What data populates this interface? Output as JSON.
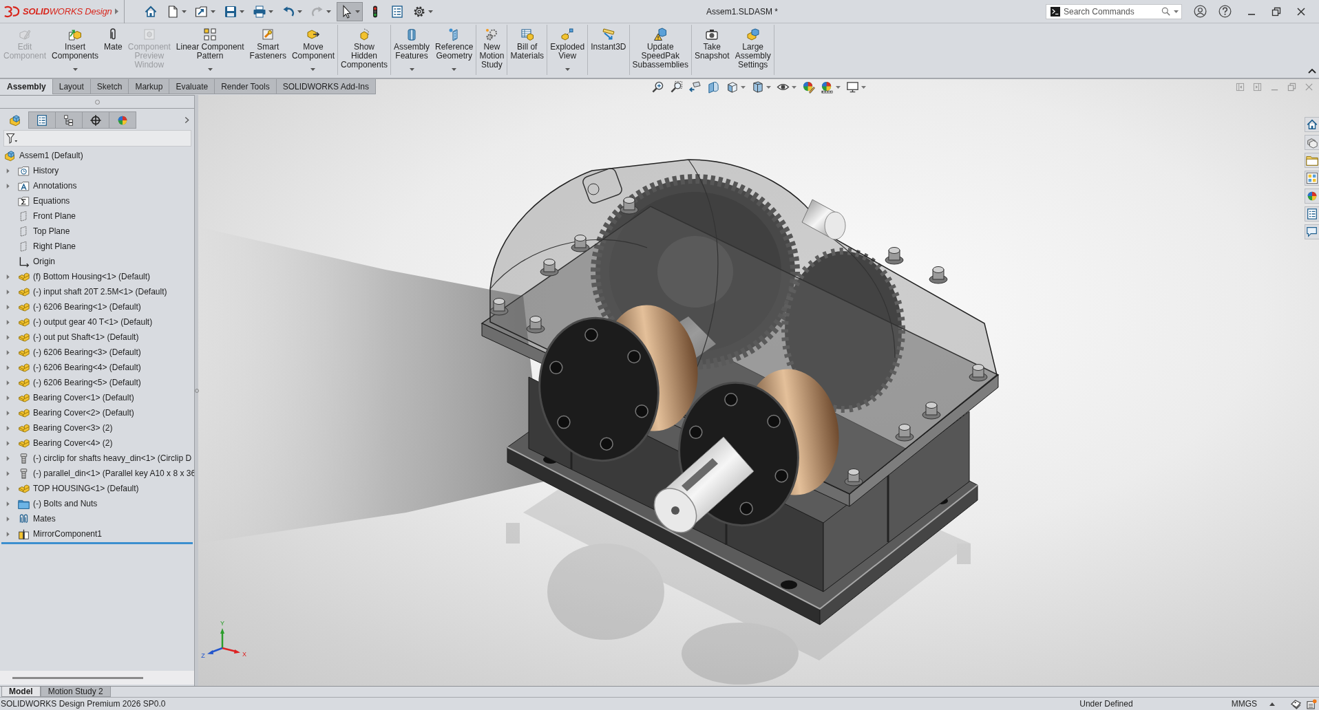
{
  "title_bar": {
    "logo_text": "**SOLID**WORKS Design",
    "quick_access": [
      {
        "kind": "home",
        "active": false,
        "disabled": false,
        "dropdown": false
      },
      {
        "kind": "new",
        "active": false,
        "disabled": false,
        "dropdown": true
      },
      {
        "kind": "open",
        "active": false,
        "disabled": false,
        "dropdown": true
      },
      {
        "kind": "save",
        "active": false,
        "disabled": false,
        "dropdown": true
      },
      {
        "kind": "print",
        "active": false,
        "disabled": false,
        "dropdown": true
      },
      {
        "kind": "undo",
        "active": false,
        "disabled": false,
        "dropdown": true
      },
      {
        "kind": "redo",
        "active": false,
        "disabled": true,
        "dropdown": true
      },
      {
        "kind": "select",
        "active": true,
        "disabled": false,
        "dropdown": true
      },
      {
        "kind": "rebuild",
        "active": false,
        "disabled": false,
        "dropdown": false
      },
      {
        "kind": "file-properties",
        "active": false,
        "disabled": false,
        "dropdown": false
      },
      {
        "kind": "options",
        "active": false,
        "disabled": false,
        "dropdown": true
      }
    ],
    "document_title": "Assem1.SLDASM *",
    "search": {
      "placeholder": "Search Commands"
    }
  },
  "command_manager": {
    "groups": [
      {
        "buttons": [
          {
            "label": "Edit\nComponent",
            "kind": "edit-component",
            "disabled": true,
            "dropdown": false
          },
          {
            "label": "Insert\nComponents",
            "kind": "insert-components",
            "disabled": false,
            "dropdown": true
          },
          {
            "label": "Mate",
            "kind": "mate",
            "disabled": false,
            "dropdown": false
          },
          {
            "label": "Component\nPreview\nWindow",
            "kind": "component-preview",
            "disabled": true,
            "dropdown": false
          },
          {
            "label": "Linear Component\nPattern",
            "kind": "linear-pattern",
            "disabled": false,
            "dropdown": true
          },
          {
            "label": "Smart\nFasteners",
            "kind": "smart-fasteners",
            "disabled": false,
            "dropdown": false
          },
          {
            "label": "Move\nComponent",
            "kind": "move-component",
            "disabled": false,
            "dropdown": true
          }
        ]
      },
      {
        "buttons": [
          {
            "label": "Show\nHidden\nComponents",
            "kind": "show-hidden",
            "disabled": false,
            "dropdown": false
          }
        ]
      },
      {
        "buttons": [
          {
            "label": "Assembly\nFeatures",
            "kind": "assembly-features",
            "disabled": false,
            "dropdown": true
          },
          {
            "label": "Reference\nGeometry",
            "kind": "reference-geometry",
            "disabled": false,
            "dropdown": true
          }
        ]
      },
      {
        "buttons": [
          {
            "label": "New\nMotion\nStudy",
            "kind": "motion-study",
            "disabled": false,
            "dropdown": false
          }
        ]
      },
      {
        "buttons": [
          {
            "label": "Bill of\nMaterials",
            "kind": "bom",
            "disabled": false,
            "dropdown": false
          }
        ]
      },
      {
        "buttons": [
          {
            "label": "Exploded\nView",
            "kind": "exploded-view",
            "disabled": false,
            "dropdown": true
          }
        ]
      },
      {
        "buttons": [
          {
            "label": "Instant3D",
            "kind": "instant3d",
            "disabled": false,
            "dropdown": false
          }
        ]
      },
      {
        "buttons": [
          {
            "label": "Update\nSpeedPak\nSubassemblies",
            "kind": "speedpak",
            "disabled": false,
            "dropdown": false
          }
        ]
      },
      {
        "buttons": [
          {
            "label": "Take\nSnapshot",
            "kind": "snapshot",
            "disabled": false,
            "dropdown": false
          },
          {
            "label": "Large\nAssembly\nSettings",
            "kind": "large-assembly",
            "disabled": false,
            "dropdown": false
          }
        ]
      }
    ]
  },
  "command_tabs": [
    {
      "label": "Assembly",
      "selected": true
    },
    {
      "label": "Layout",
      "selected": false
    },
    {
      "label": "Sketch",
      "selected": false
    },
    {
      "label": "Markup",
      "selected": false
    },
    {
      "label": "Evaluate",
      "selected": false
    },
    {
      "label": "Render Tools",
      "selected": false
    },
    {
      "label": "SOLIDWORKS Add-Ins",
      "selected": false
    }
  ],
  "view_toolbar": [
    {
      "kind": "zoom-fit",
      "dropdown": false
    },
    {
      "kind": "zoom-area",
      "dropdown": false
    },
    {
      "kind": "previous-view",
      "dropdown": false
    },
    {
      "kind": "section-view",
      "dropdown": false
    },
    {
      "kind": "view-orientation",
      "dropdown": true
    },
    {
      "kind": "display-style",
      "dropdown": true
    },
    {
      "kind": "hide-show",
      "dropdown": true
    },
    {
      "kind": "edit-appearance",
      "dropdown": false
    },
    {
      "kind": "apply-scene",
      "dropdown": true
    },
    {
      "kind": "view-settings",
      "dropdown": true
    }
  ],
  "feature_manager": {
    "tabs": [
      {
        "kind": "feature-tree",
        "selected": true
      },
      {
        "kind": "property-manager",
        "selected": false
      },
      {
        "kind": "configuration-manager",
        "selected": false
      },
      {
        "kind": "dimxpert",
        "selected": false
      },
      {
        "kind": "display-manager",
        "selected": false
      }
    ],
    "tree": {
      "label": "Assem1 (Default)",
      "kind": "assembly",
      "selected": false,
      "children": [
        {
          "label": "History",
          "kind": "history",
          "expanded": false,
          "selected": false
        },
        {
          "label": "Annotations",
          "kind": "annotations",
          "expanded": false,
          "selected": false
        },
        {
          "label": "Equations",
          "kind": "equations",
          "selected": false
        },
        {
          "label": "Front Plane",
          "kind": "plane",
          "selected": false
        },
        {
          "label": "Top Plane",
          "kind": "plane",
          "selected": false
        },
        {
          "label": "Right Plane",
          "kind": "plane",
          "selected": false
        },
        {
          "label": "Origin",
          "kind": "origin",
          "selected": false
        },
        {
          "label": "(f) Bottom Housing<1> (Default)",
          "kind": "part",
          "expanded": false,
          "selected": false
        },
        {
          "label": "(-) input shaft 20T 2.5M<1> (Default)",
          "kind": "part",
          "expanded": false,
          "selected": false
        },
        {
          "label": "(-) 6206 Bearing<1> (Default)",
          "kind": "part",
          "expanded": false,
          "selected": false
        },
        {
          "label": "(-) output gear 40 T<1> (Default)",
          "kind": "part",
          "expanded": false,
          "selected": false
        },
        {
          "label": "(-) out put Shaft<1> (Default)",
          "kind": "part",
          "expanded": false,
          "selected": false
        },
        {
          "label": "(-) 6206 Bearing<3> (Default)",
          "kind": "part",
          "expanded": false,
          "selected": false
        },
        {
          "label": "(-) 6206 Bearing<4> (Default)",
          "kind": "part",
          "expanded": false,
          "selected": false
        },
        {
          "label": "(-) 6206 Bearing<5> (Default)",
          "kind": "part",
          "expanded": false,
          "selected": false
        },
        {
          "label": "Bearing Cover<1> (Default)",
          "kind": "part",
          "expanded": false,
          "selected": false
        },
        {
          "label": "Bearing Cover<2> (Default)",
          "kind": "part",
          "expanded": false,
          "selected": false
        },
        {
          "label": "Bearing Cover<3> (2)",
          "kind": "part",
          "expanded": false,
          "selected": false
        },
        {
          "label": "Bearing Cover<4> (2)",
          "kind": "part",
          "expanded": false,
          "selected": false
        },
        {
          "label": "(-) circlip for shafts heavy_din<1> (Circlip D",
          "kind": "toolbox-part",
          "expanded": false,
          "selected": false
        },
        {
          "label": "(-) parallel_din<1> (Parallel key A10 x 8 x 36",
          "kind": "toolbox-part",
          "expanded": false,
          "selected": false
        },
        {
          "label": "TOP HOUSING<1> (Default)",
          "kind": "part",
          "expanded": false,
          "selected": false
        },
        {
          "label": "(-) Bolts and Nuts",
          "kind": "folder",
          "expanded": false,
          "selected": false
        },
        {
          "label": "Mates",
          "kind": "mates",
          "expanded": false,
          "selected": false
        },
        {
          "label": "MirrorComponent1",
          "kind": "mirror",
          "expanded": false,
          "selected": false
        }
      ]
    }
  },
  "graphics_area": {
    "triad": {
      "x_label": "X",
      "y_label": "Y",
      "z_label": "Z"
    }
  },
  "bottom_tabs": [
    {
      "label": "Model",
      "selected": true
    },
    {
      "label": "Motion Study 2",
      "selected": false
    }
  ],
  "status_bar": {
    "product": "SOLIDWORKS Design Premium 2026 SP0.0",
    "state": "Under Defined",
    "units": "MMGS"
  }
}
